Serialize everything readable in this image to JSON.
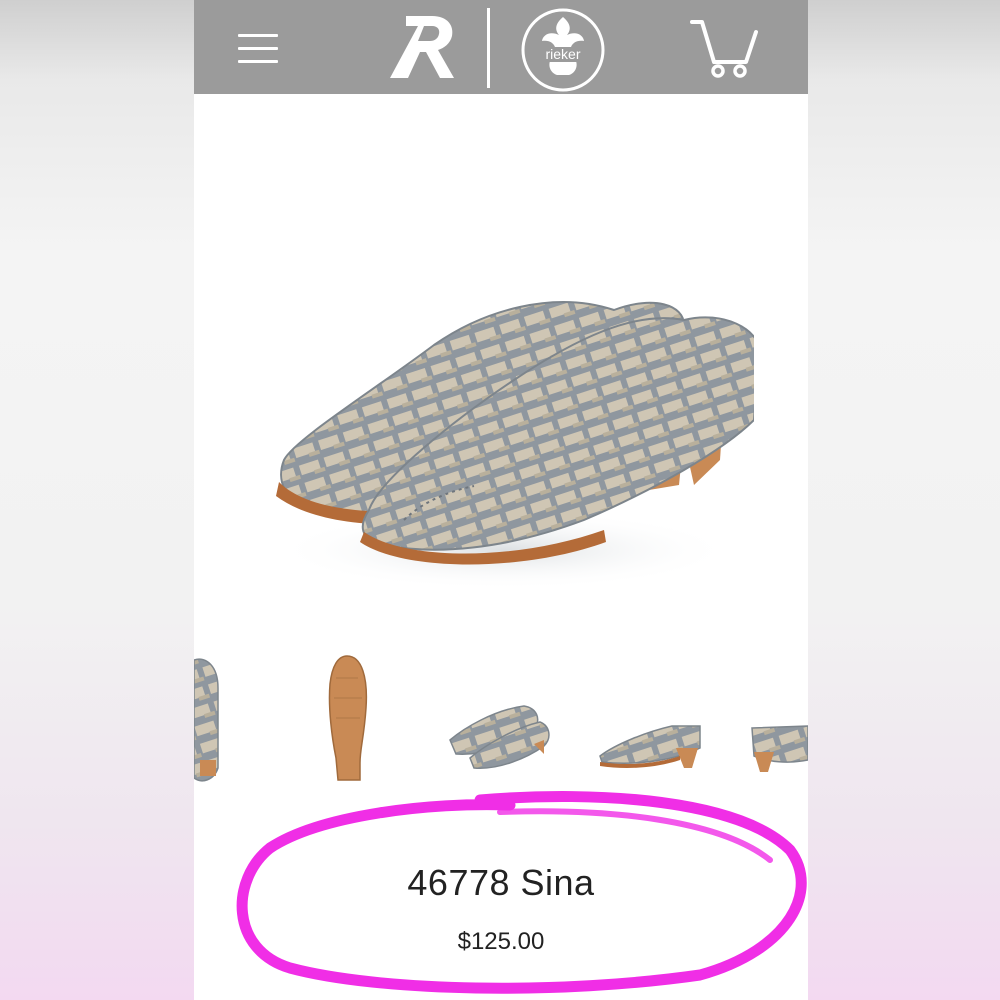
{
  "header": {
    "menu_icon": "hamburger-menu-icon",
    "brand_logo_icon": "rieker-r-logo-icon",
    "brand_emblem_icon": "rieker-fleur-emblem-icon",
    "brand_emblem_text": "rieker",
    "cart_icon": "shopping-cart-icon"
  },
  "product": {
    "title": "46778 Sina",
    "price": "$125.00",
    "main_image": "grey-woven-slingback-shoe-pair",
    "thumbnails": [
      "shoe-back-view-partial",
      "shoe-sole-view",
      "shoe-pair-view",
      "shoe-side-view",
      "shoe-side-view-partial"
    ]
  },
  "colors": {
    "header_bg": "#9b9b9b",
    "highlight": "#f02ee6",
    "shoe_grey": "#8f979f",
    "shoe_metallic": "#cfc6b4",
    "sole_tan": "#c98a55"
  }
}
